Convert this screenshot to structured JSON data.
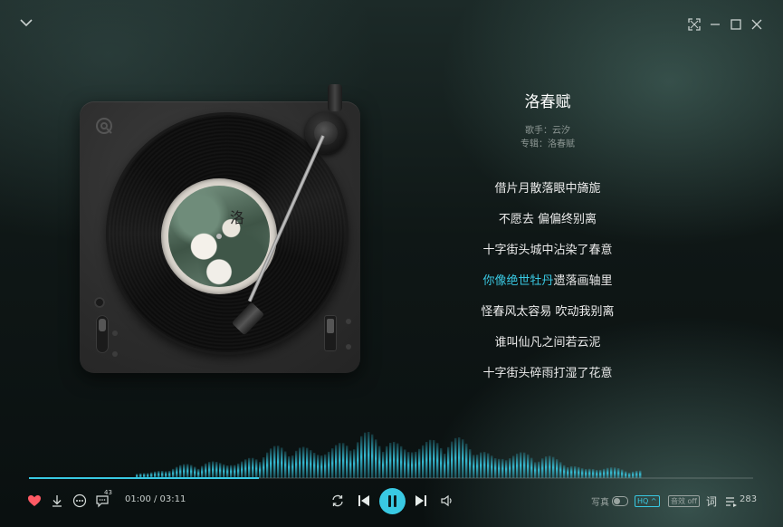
{
  "window": {
    "collapse_icon": "chevron-down-icon",
    "controls": [
      "fullscreen-icon",
      "minimize-icon",
      "maximize-icon",
      "close-icon"
    ]
  },
  "album_art_char": "洛",
  "song": {
    "title": "洛春赋",
    "singer_label": "歌手：云汐",
    "album_label": "专辑：洛春赋"
  },
  "lyrics": [
    {
      "text": "借片月散落眼中旖旎",
      "highlight": ""
    },
    {
      "text": "不愿去 偏偏终别离",
      "highlight": ""
    },
    {
      "text": "十字街头城中沾染了春意",
      "highlight": ""
    },
    {
      "text": "遗落画轴里",
      "highlight": "你像绝世牡丹"
    },
    {
      "text": "怪春风太容易 吹动我别离",
      "highlight": ""
    },
    {
      "text": "谁叫仙凡之间若云泥",
      "highlight": ""
    },
    {
      "text": "十字街头碎雨打湿了花意",
      "highlight": ""
    }
  ],
  "player": {
    "time": "01:00 / 03:11",
    "progress": 0.317,
    "comment_count": "43",
    "portrait_label": "写真",
    "quality_label": "HQ ^",
    "effect_label": "音效 off",
    "lyrics_label": "词",
    "playlist_count": "283",
    "accent_color": "#39c9e3",
    "like_color": "#ff5a64"
  }
}
